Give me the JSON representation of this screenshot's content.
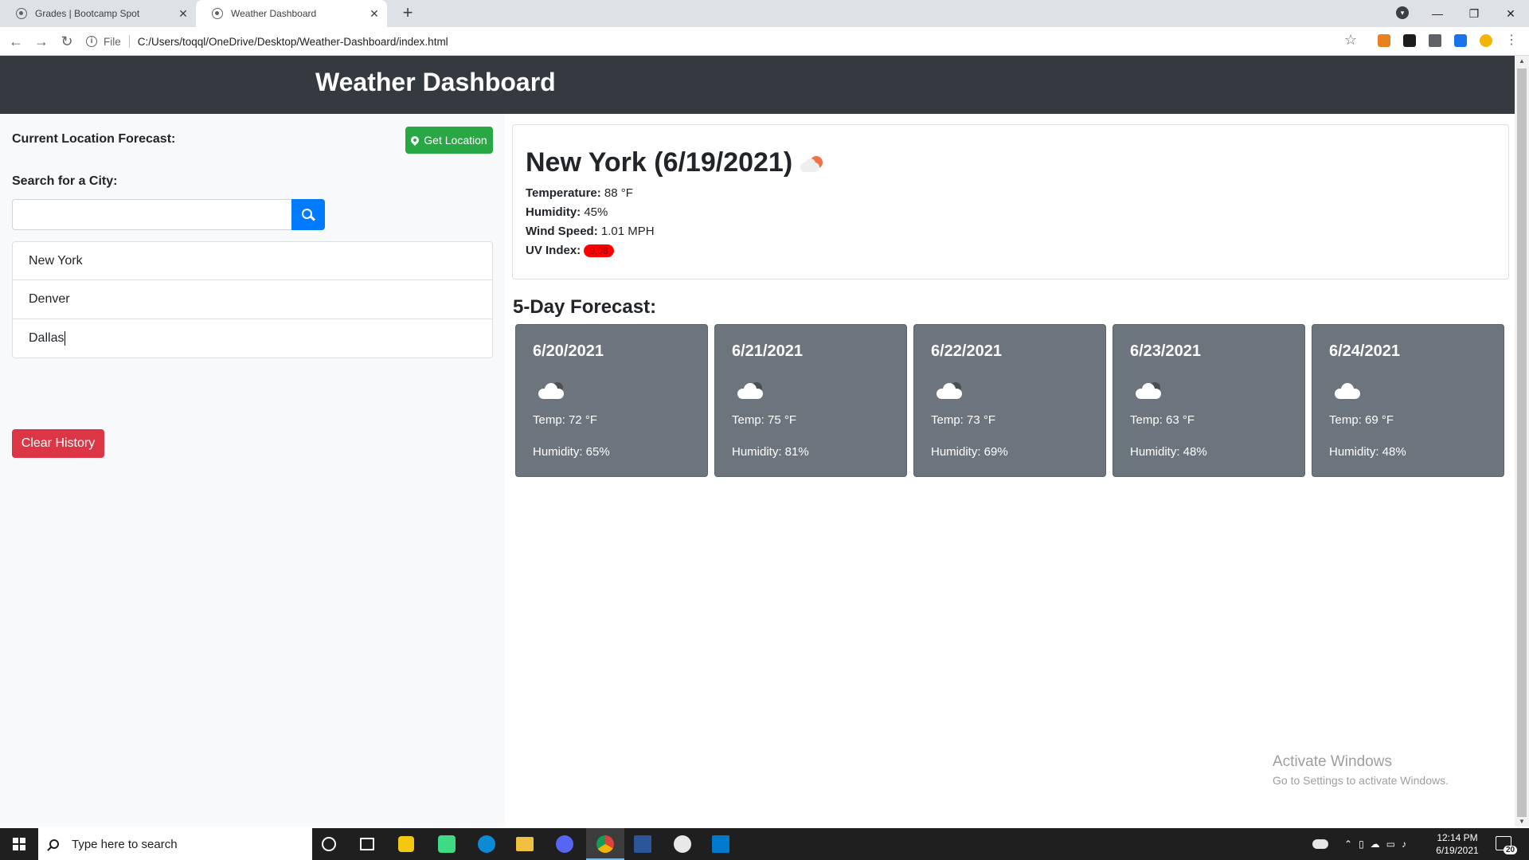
{
  "browser": {
    "tabs": [
      {
        "title": "Grades | Bootcamp Spot",
        "active": false
      },
      {
        "title": "Weather Dashboard",
        "active": true
      }
    ],
    "url_scheme": "File",
    "url": "C:/Users/toqql/OneDrive/Desktop/Weather-Dashboard/index.html"
  },
  "header": {
    "title": "Weather Dashboard"
  },
  "sidebar": {
    "current_location_label": "Current Location Forecast:",
    "get_location_label": "Get Location",
    "search_label": "Search for a City:",
    "search_value": "",
    "history": [
      "New York",
      "Denver",
      "Dallas"
    ],
    "clear_label": "Clear History"
  },
  "current": {
    "title": "New York (6/19/2021)",
    "icon": "partly-cloudy-sun-icon",
    "temperature_label": "Temperature:",
    "temperature": "88 °F",
    "humidity_label": "Humidity:",
    "humidity": "45%",
    "wind_label": "Wind Speed:",
    "wind": "1.01 MPH",
    "uv_label": "UV Index:",
    "uv": "9.08",
    "uv_color": "#ff0000"
  },
  "forecast": {
    "title": "5-Day Forecast:",
    "days": [
      {
        "date": "6/20/2021",
        "icon": "cloud-icon",
        "temp": "Temp: 72 °F",
        "humidity": "Humidity: 65%"
      },
      {
        "date": "6/21/2021",
        "icon": "cloud-icon",
        "temp": "Temp: 75 °F",
        "humidity": "Humidity: 81%"
      },
      {
        "date": "6/22/2021",
        "icon": "cloud-icon",
        "temp": "Temp: 73 °F",
        "humidity": "Humidity: 69%"
      },
      {
        "date": "6/23/2021",
        "icon": "cloud-icon",
        "temp": "Temp: 63 °F",
        "humidity": "Humidity: 48%"
      },
      {
        "date": "6/24/2021",
        "icon": "cloud-icon",
        "temp": "Temp: 69 °F",
        "humidity": "Humidity: 48%"
      }
    ]
  },
  "watermark": {
    "line1": "Activate Windows",
    "line2": "Go to Settings to activate Windows."
  },
  "taskbar": {
    "search_placeholder": "Type here to search",
    "time": "12:14 PM",
    "date": "6/19/2021",
    "notifications": "20"
  },
  "colors": {
    "header_bg": "#343a40",
    "get_location": "#28a745",
    "search_button": "#007bff",
    "clear_history": "#dc3545",
    "forecast_card": "#6c757d"
  }
}
